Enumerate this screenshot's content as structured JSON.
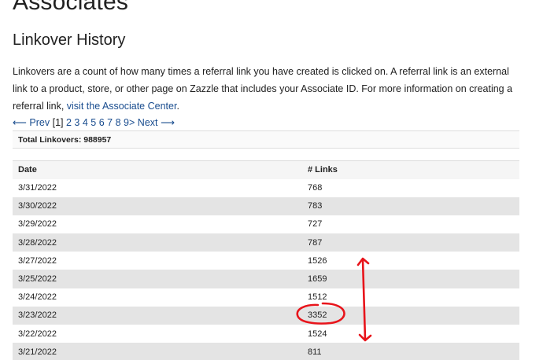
{
  "header": {
    "page_title": "Associates",
    "section_title": "Linkover History"
  },
  "intro": {
    "text": "Linkovers are a count of how many times a referral link you have created is clicked on. A referral link is an external link to a product, store, or other page on Zazzle that includes your Associate ID. For more information on creating a referral link, ",
    "link_text": "visit the Associate Center",
    "after": "."
  },
  "pager": {
    "prev_label": "⟵ Prev",
    "current_page": "[1]",
    "pages": [
      "2",
      "3",
      "4",
      "5",
      "6",
      "7",
      "8",
      "9>"
    ],
    "next_label": "Next ⟶"
  },
  "totals": {
    "label": "Total Linkovers: 988957"
  },
  "table": {
    "headers": {
      "date": "Date",
      "links": "# Links"
    },
    "rows": [
      {
        "date": "3/31/2022",
        "links": "768"
      },
      {
        "date": "3/30/2022",
        "links": "783"
      },
      {
        "date": "3/29/2022",
        "links": "727"
      },
      {
        "date": "3/28/2022",
        "links": "787"
      },
      {
        "date": "3/27/2022",
        "links": "1526"
      },
      {
        "date": "3/25/2022",
        "links": "1659"
      },
      {
        "date": "3/24/2022",
        "links": "1512"
      },
      {
        "date": "3/23/2022",
        "links": "3352"
      },
      {
        "date": "3/22/2022",
        "links": "1524"
      },
      {
        "date": "3/21/2022",
        "links": "811"
      }
    ]
  },
  "annotation": {
    "color": "#e8141b"
  }
}
